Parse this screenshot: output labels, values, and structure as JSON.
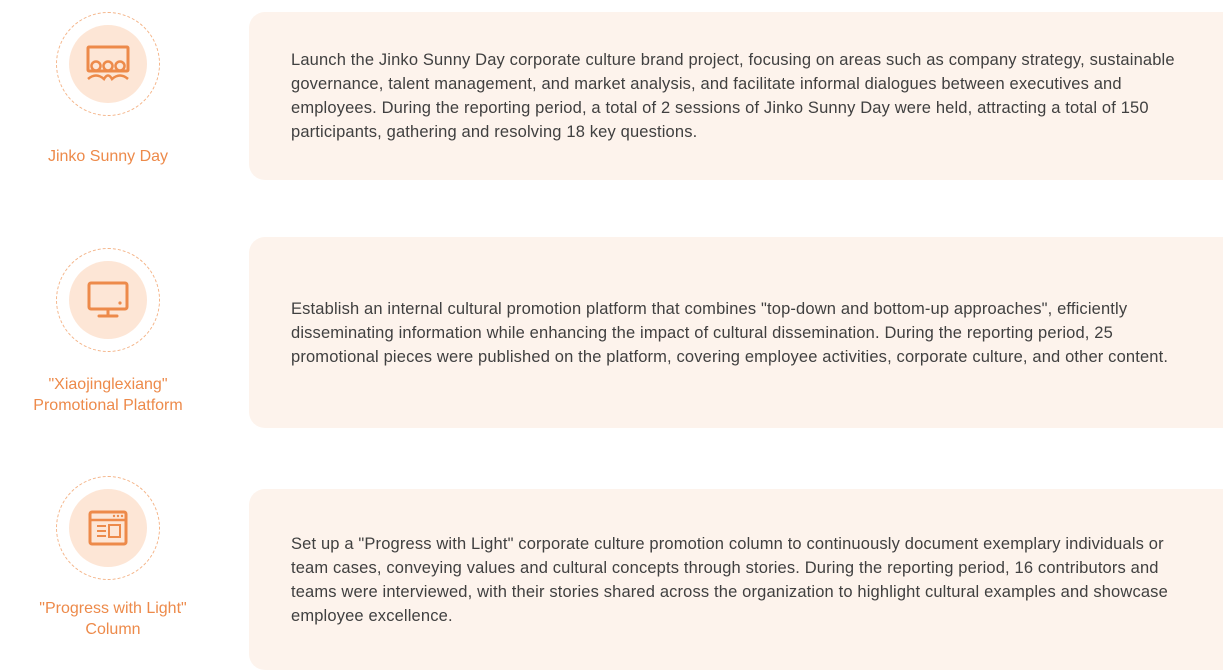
{
  "items": [
    {
      "label": "Jinko Sunny Day",
      "icon": "meeting-icon",
      "text": "Launch the Jinko Sunny Day corporate culture brand project, focusing on areas such as company strategy, sustainable governance, talent management, and market analysis, and facilitate informal dialogues between executives and employees. During the reporting period, a total of 2 sessions of Jinko Sunny Day were held, attracting a total of 150 participants, gathering and resolving 18 key questions."
    },
    {
      "label": "\"Xiaojinglexiang\"\nPromotional Platform",
      "icon": "monitor-icon",
      "text": "Establish an internal cultural promotion platform that combines \"top-down and bottom-up approaches\", efficiently disseminating information while enhancing the impact of cultural dissemination. During the reporting period, 25 promotional pieces were published on the platform, covering employee activities, corporate culture, and other content."
    },
    {
      "label": "\"Progress with Light\"\nColumn",
      "icon": "browser-window-icon",
      "text": "Set up a \"Progress with Light\" corporate culture promotion column to continuously document exemplary individuals or team cases, conveying values and cultural concepts through stories. During the reporting period, 16 contributors and teams were interviewed, with their stories shared across the organization to highlight cultural examples and showcase employee excellence."
    }
  ],
  "colors": {
    "accent": "#ed8a4a",
    "icon_bg": "#fde6d6",
    "card_bg": "#fdf3ec",
    "text": "#404040"
  }
}
